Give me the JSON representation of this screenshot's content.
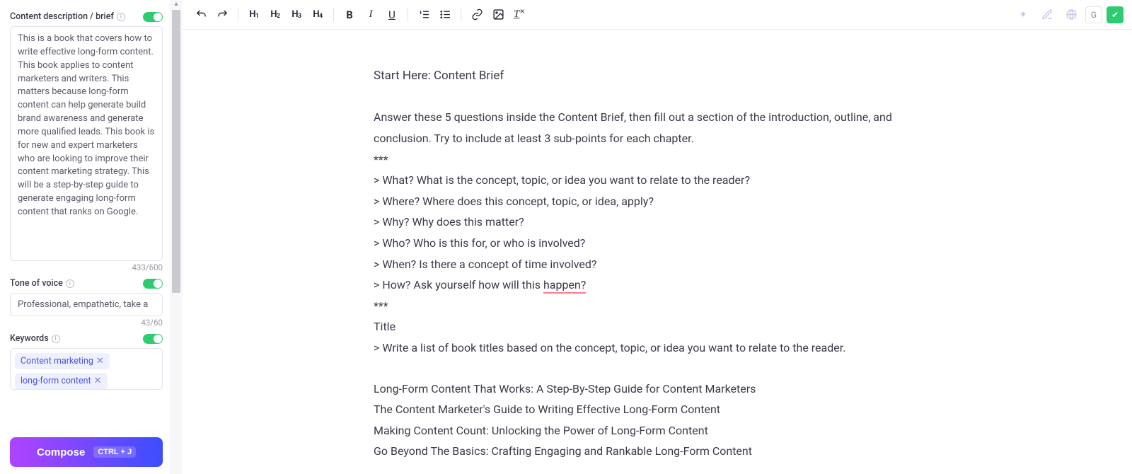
{
  "sidebar": {
    "brief": {
      "label": "Content description / brief",
      "value": "This is a book that covers how to write effective long-form content. This book applies to content marketers and writers. This matters because long-form content can help generate build brand awareness and generate more qualified leads. This book is for new and expert marketers who are looking to improve their content marketing strategy. This will be a step-by-step guide to generate engaging long-form content that ranks on Google.",
      "counter": "433/600"
    },
    "tone": {
      "label": "Tone of voice",
      "value": "Professional, empathetic, take a",
      "counter": "43/60"
    },
    "keywords": {
      "label": "Keywords",
      "tags": [
        "Content marketing",
        "long-form content"
      ]
    },
    "compose": {
      "label": "Compose",
      "shortcut": "CTRL + J"
    }
  },
  "toolbar": {
    "headings": [
      "H1",
      "H2",
      "H3",
      "H4"
    ]
  },
  "document": {
    "title": "Start Here: Content Brief",
    "intro": "Answer these 5 questions inside the Content Brief, then fill out a section of the introduction, outline, and conclusion. Try to include at least 3 sub-points for each chapter.",
    "sep": "***",
    "q1": "> What? What is the concept, topic, or idea you want to relate to the reader?",
    "q2": "> Where? Where does this concept, topic, or idea, apply?",
    "q3": "> Why? Why does this matter?",
    "q4": "> Who? Who is this for, or who is involved?",
    "q5": "> When? Is there a concept of time involved?",
    "q6_pre": "> How? Ask yourself how will this ",
    "q6_err": "happen?",
    "titleLabel": "Title",
    "titlePrompt": "> Write a list of book titles based on the concept, topic, or idea you want to relate to the reader.",
    "t1": "Long-Form Content That Works: A Step-By-Step Guide for Content Marketers",
    "t2": "The Content Marketer's Guide to Writing Effective Long-Form Content",
    "t3": "Making Content Count: Unlocking the Power of Long-Form Content",
    "t4": "Go Beyond The Basics: Crafting Engaging and Rankable Long-Form Content"
  }
}
